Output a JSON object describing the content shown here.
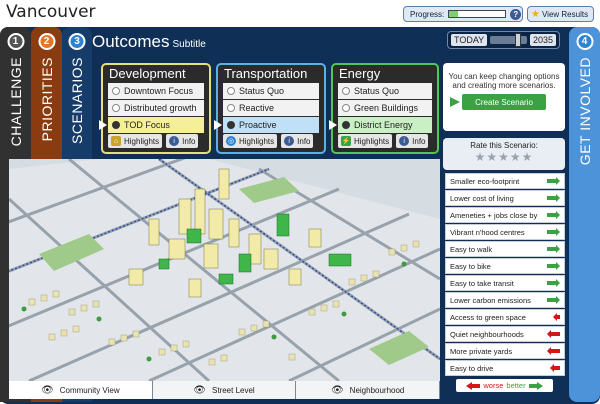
{
  "app": {
    "title": "Vancouver"
  },
  "header": {
    "progress_label": "Progress:",
    "progress_value": 0.15,
    "help_glyph": "?",
    "view_results_label": "View Results",
    "view_results_icon": "star-icon"
  },
  "tabs": [
    {
      "num": "1",
      "label": "CHALLENGE"
    },
    {
      "num": "2",
      "label": "PRIORITIES"
    },
    {
      "num": "3",
      "label": "SCENARIOS"
    },
    {
      "num": "4",
      "label": "GET INVOLVED"
    }
  ],
  "section": {
    "title": "Outcomes",
    "subtitle": "Subtitle"
  },
  "timeline": {
    "today_label": "TODAY",
    "end_label": "2035",
    "slider_value": 0.75
  },
  "panels": [
    {
      "title": "Development",
      "border_color": "#e9df78",
      "selected_color": "#f5ef9a",
      "options": [
        "Downtown Focus",
        "Distributed growth",
        "TOD Focus"
      ],
      "selected": 2,
      "highlights_label": "Highlights",
      "info_label": "Info",
      "icon": "house-icon",
      "icon_color": "#c9a227"
    },
    {
      "title": "Transportation",
      "border_color": "#5ab2e3",
      "selected_color": "#bfe0f6",
      "options": [
        "Status Quo",
        "Reactive",
        "Proactive"
      ],
      "selected": 2,
      "highlights_label": "Highlights",
      "info_label": "Info",
      "icon": "target-icon",
      "icon_color": "#2f84d0"
    },
    {
      "title": "Energy",
      "border_color": "#55c45a",
      "selected_color": "#c9f0c4",
      "options": [
        "Status Quo",
        "Green Buildings",
        "District Energy"
      ],
      "selected": 2,
      "highlights_label": "Highlights",
      "info_label": "Info",
      "icon": "bolt-icon",
      "icon_color": "#3aa243"
    }
  ],
  "create_panel": {
    "text": "You can keep changing options and creating more scenarios.",
    "button_label": "Create Scenario"
  },
  "rating": {
    "label": "Rate this Scenario:",
    "stars": "★★★★★"
  },
  "criteria": [
    {
      "label": "Smaller eco-footprint",
      "dir": "better",
      "size": 3
    },
    {
      "label": "Lower cost of living",
      "dir": "better",
      "size": 3
    },
    {
      "label": "Ameneties + jobs close by",
      "dir": "better",
      "size": 3
    },
    {
      "label": "Vibrant n'hood centres",
      "dir": "better",
      "size": 3
    },
    {
      "label": "Easy to walk",
      "dir": "better",
      "size": 3
    },
    {
      "label": "Easy to bike",
      "dir": "better",
      "size": 3
    },
    {
      "label": "Easy to take transit",
      "dir": "better",
      "size": 3
    },
    {
      "label": "Lower carbon emissions",
      "dir": "better",
      "size": 3
    },
    {
      "label": "Access to green space",
      "dir": "worse",
      "size": 1
    },
    {
      "label": "Quiet neighbourhoods",
      "dir": "worse",
      "size": 3
    },
    {
      "label": "More private yards",
      "dir": "worse",
      "size": 3
    },
    {
      "label": "Easy to drive",
      "dir": "worse",
      "size": 2
    }
  ],
  "legend": {
    "worse": "worse",
    "better": "better",
    "worse_color": "#d2171b",
    "better_color": "#3aa243"
  },
  "views": [
    {
      "label": "Community View",
      "active": true
    },
    {
      "label": "Street Level",
      "active": false
    },
    {
      "label": "Neighbourhood",
      "active": false
    }
  ]
}
